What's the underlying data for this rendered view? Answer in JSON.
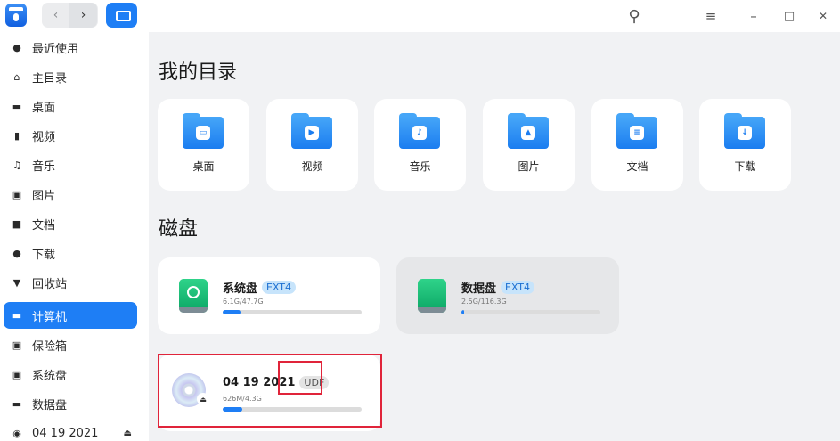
{
  "titlebar": {
    "back_glyph": "‹",
    "forward_glyph": "›",
    "search_glyph": "⚲",
    "menu_glyph": "≡",
    "minimize_glyph": "–",
    "maximize_glyph": "□",
    "close_glyph": "✕"
  },
  "sidebar": {
    "items": [
      {
        "label": "最近使用",
        "icon": "clock-icon",
        "glyph": "●"
      },
      {
        "label": "主目录",
        "icon": "home-icon",
        "glyph": "⌂"
      },
      {
        "label": "桌面",
        "icon": "desktop-icon",
        "glyph": "▬"
      },
      {
        "label": "视频",
        "icon": "video-icon",
        "glyph": "▮"
      },
      {
        "label": "音乐",
        "icon": "music-icon",
        "glyph": "♫"
      },
      {
        "label": "图片",
        "icon": "image-icon",
        "glyph": "▣"
      },
      {
        "label": "文档",
        "icon": "document-icon",
        "glyph": "■"
      },
      {
        "label": "下载",
        "icon": "download-icon",
        "glyph": "●"
      },
      {
        "label": "回收站",
        "icon": "trash-icon",
        "glyph": "▼"
      },
      {
        "label": "计算机",
        "icon": "computer-icon",
        "glyph": "▬",
        "active": true
      },
      {
        "label": "保险箱",
        "icon": "vault-icon",
        "glyph": "▣"
      },
      {
        "label": "系统盘",
        "icon": "system-disk-icon",
        "glyph": "▣"
      },
      {
        "label": "数据盘",
        "icon": "data-disk-icon",
        "glyph": "▬"
      },
      {
        "label": "04 19 2021",
        "icon": "cd-icon",
        "glyph": "◉"
      }
    ],
    "eject_glyph": "⏏"
  },
  "main": {
    "folders_title": "我的目录",
    "folders": [
      {
        "label": "桌面",
        "icon": "desktop-folder-icon",
        "emblem": "▭"
      },
      {
        "label": "视频",
        "icon": "video-folder-icon",
        "emblem": "▶"
      },
      {
        "label": "音乐",
        "icon": "music-folder-icon",
        "emblem": "♪"
      },
      {
        "label": "图片",
        "icon": "pictures-folder-icon",
        "emblem": "▲"
      },
      {
        "label": "文档",
        "icon": "documents-folder-icon",
        "emblem": "≡"
      },
      {
        "label": "下载",
        "icon": "downloads-folder-icon",
        "emblem": "↓"
      }
    ],
    "disks_title": "磁盘",
    "disks": [
      {
        "name": "系统盘",
        "fs": "EXT4",
        "size": "6.1G/47.7G",
        "usage": 0.128
      },
      {
        "name": "数据盘",
        "fs": "EXT4",
        "size": "2.5G/116.3G",
        "usage": 0.021
      },
      {
        "name": "04 19 2021",
        "fs": "UDF",
        "size": "626M/4.3G",
        "usage": 0.142
      }
    ]
  },
  "colors": {
    "accent": "#1e7ef5",
    "highlight": "#e0243a",
    "disk_green": "#0aa564"
  }
}
